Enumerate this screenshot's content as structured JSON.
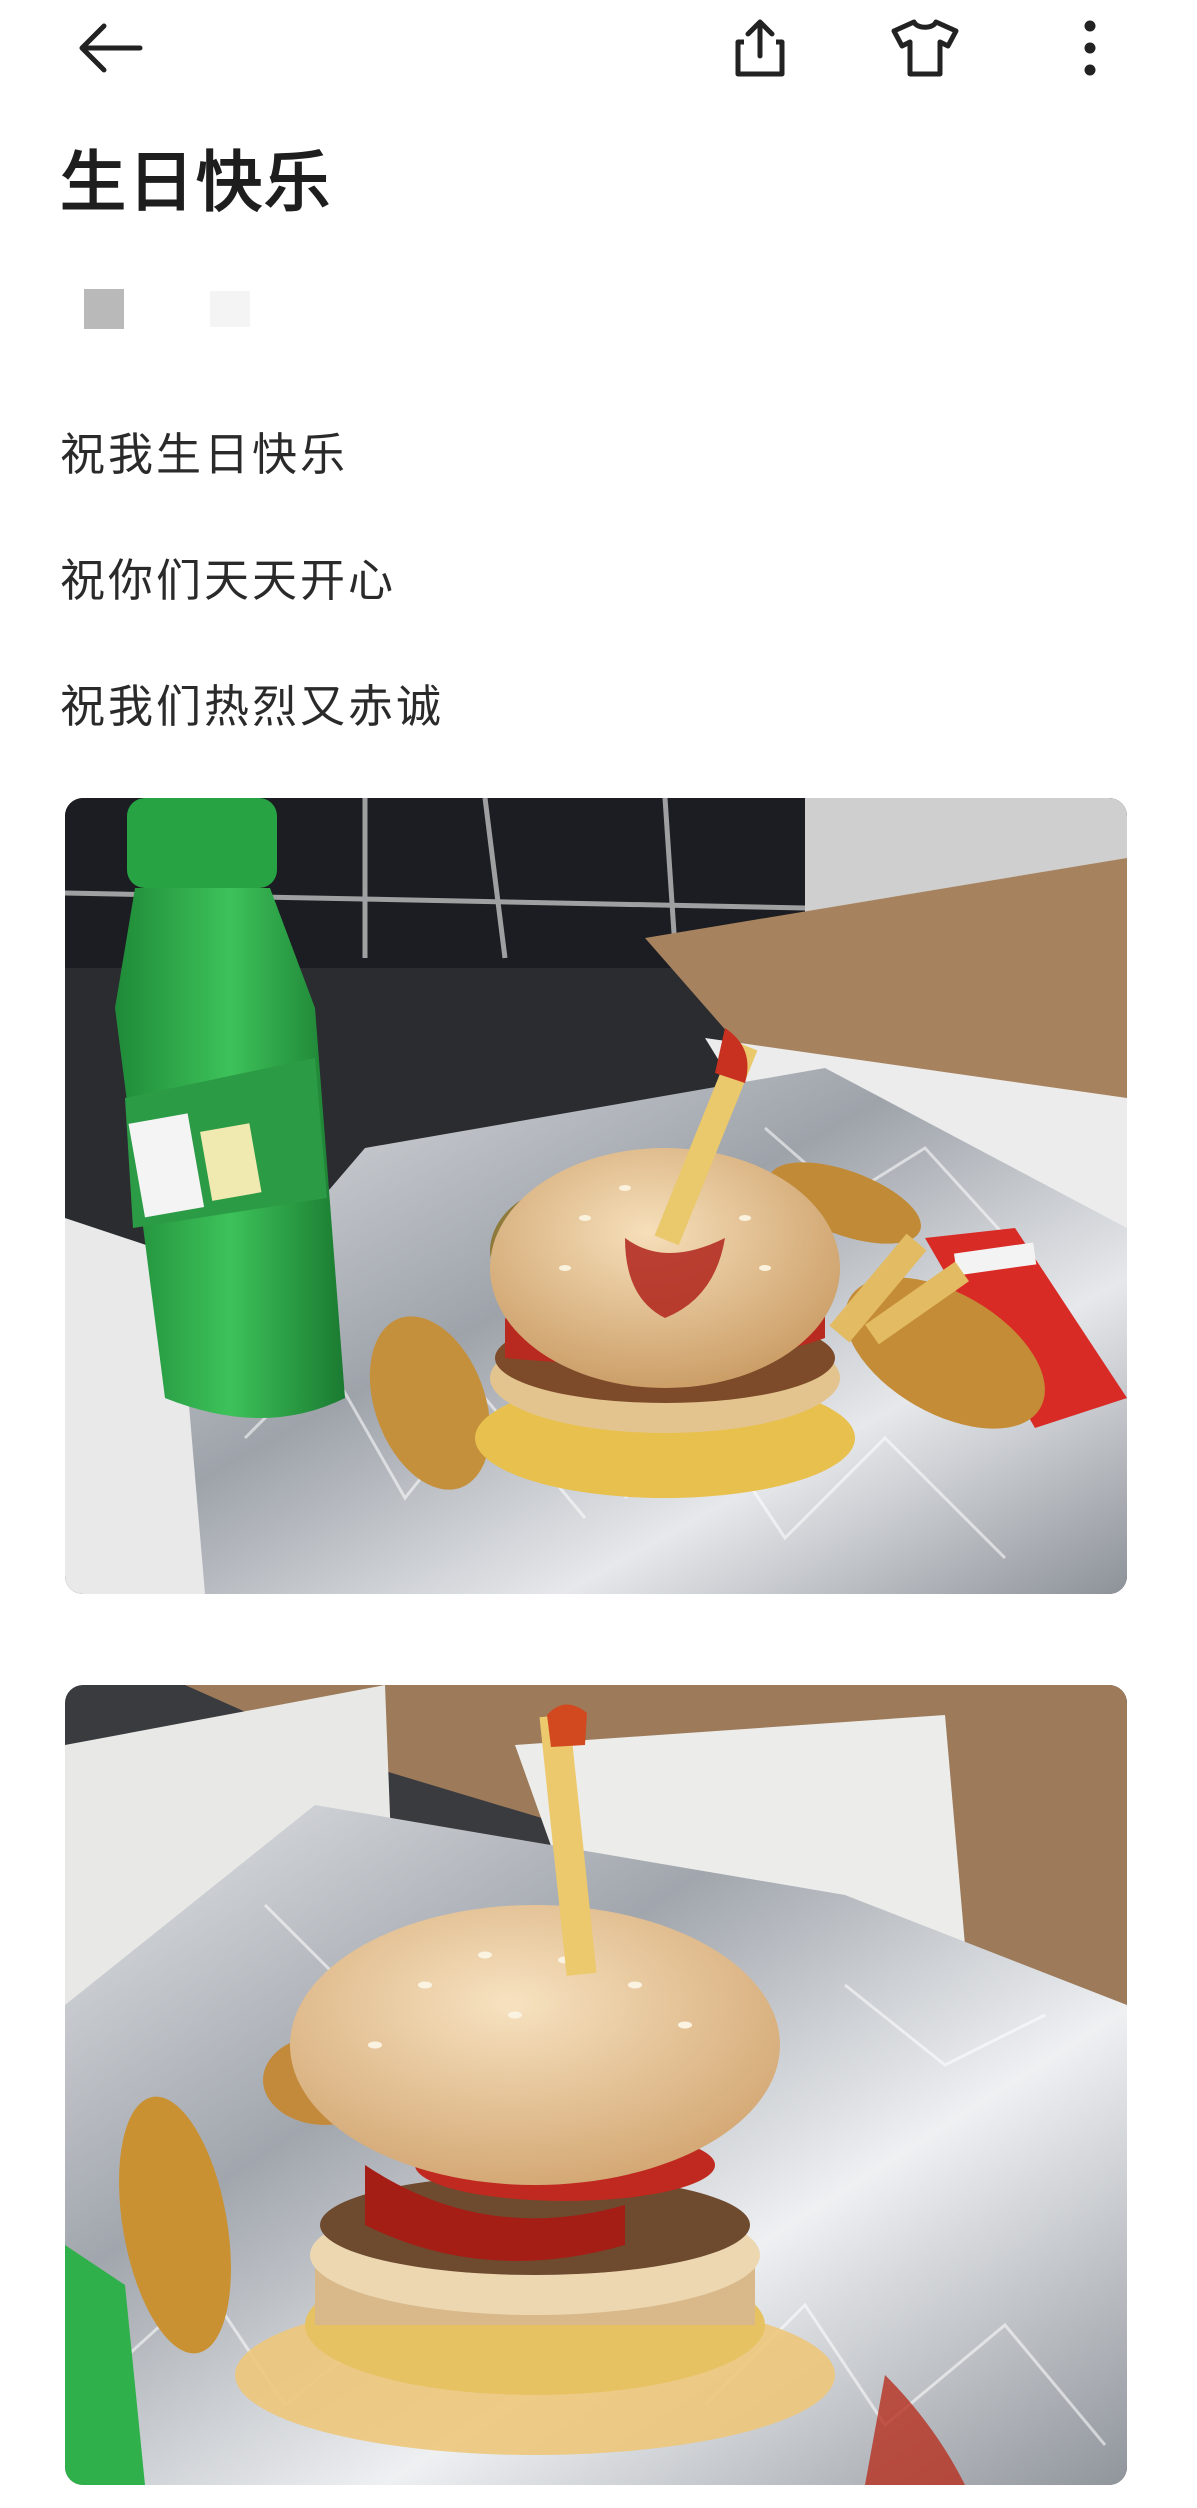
{
  "toolbar": {
    "back_icon": "arrow-left-icon",
    "share_icon": "share-icon",
    "theme_icon": "tshirt-icon",
    "more_icon": "more-vertical-icon"
  },
  "note": {
    "title": "生日快乐",
    "lines": [
      "祝我生日快乐",
      "祝你们天天开心",
      "祝我们热烈又赤诚"
    ]
  },
  "photos": [
    {
      "name": "burger-with-sprite-photo"
    },
    {
      "name": "burger-closeup-photo"
    }
  ],
  "colors": {
    "text": "#222222",
    "background": "#ffffff",
    "foil": "#c9ccd1",
    "bun": "#e8c79a",
    "bottle": "#2fb04a",
    "ketchup": "#c2261a"
  }
}
